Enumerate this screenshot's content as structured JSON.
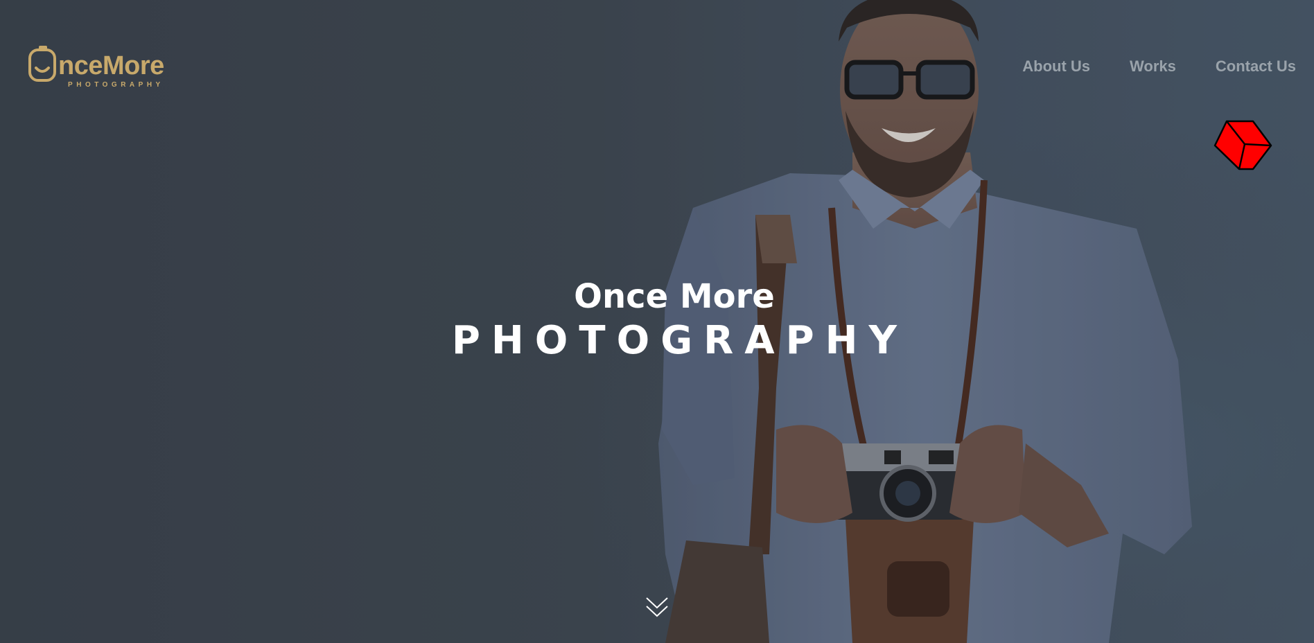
{
  "brand": {
    "name": "nceMore",
    "tagline": "PHOTOGRAPHY",
    "color": "#c8a96b"
  },
  "nav": {
    "items": [
      {
        "label": "About Us"
      },
      {
        "label": "Works"
      },
      {
        "label": "Contact Us"
      }
    ],
    "color": "#9aa3ab"
  },
  "hero": {
    "line1": "Once More",
    "line2": "PHOTOGRAPHY"
  },
  "icons": {
    "logo": "camera-smile-icon",
    "floating_widget": "cube-icon",
    "scroll": "double-chevron-down-icon"
  },
  "colors": {
    "background": "#3e4750",
    "cube": "#ff0000",
    "text": "#ffffff"
  }
}
